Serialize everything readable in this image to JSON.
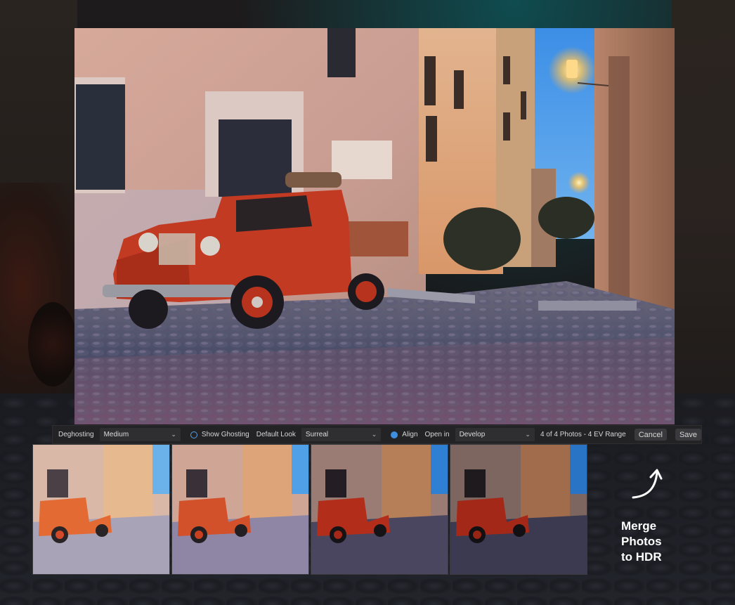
{
  "toolbar": {
    "deghosting_label": "Deghosting",
    "deghosting_value": "Medium",
    "show_ghosting_label": "Show Ghosting",
    "default_look_label": "Default Look",
    "default_look_value": "Surreal",
    "align_label": "Align",
    "open_in_label": "Open in",
    "open_in_value": "Develop",
    "photo_summary": "4 of 4 Photos - 4 EV Range",
    "cancel_label": "Cancel",
    "save_label": "Save",
    "show_ghosting_checked": false,
    "align_checked": true
  },
  "thumbnails": [
    {
      "name": "exposure-1"
    },
    {
      "name": "exposure-2"
    },
    {
      "name": "exposure-3"
    },
    {
      "name": "exposure-4"
    }
  ],
  "callout": {
    "line1": "Merge",
    "line2": "Photos",
    "line3": "to HDR"
  },
  "icons": {
    "dropdown": "chevron-down-icon",
    "callout_arrow": "curved-arrow-up-icon"
  },
  "colors": {
    "accent": "#3f8fe0",
    "toolbar_bg": "#232325",
    "truck_red": "#c23a22"
  }
}
